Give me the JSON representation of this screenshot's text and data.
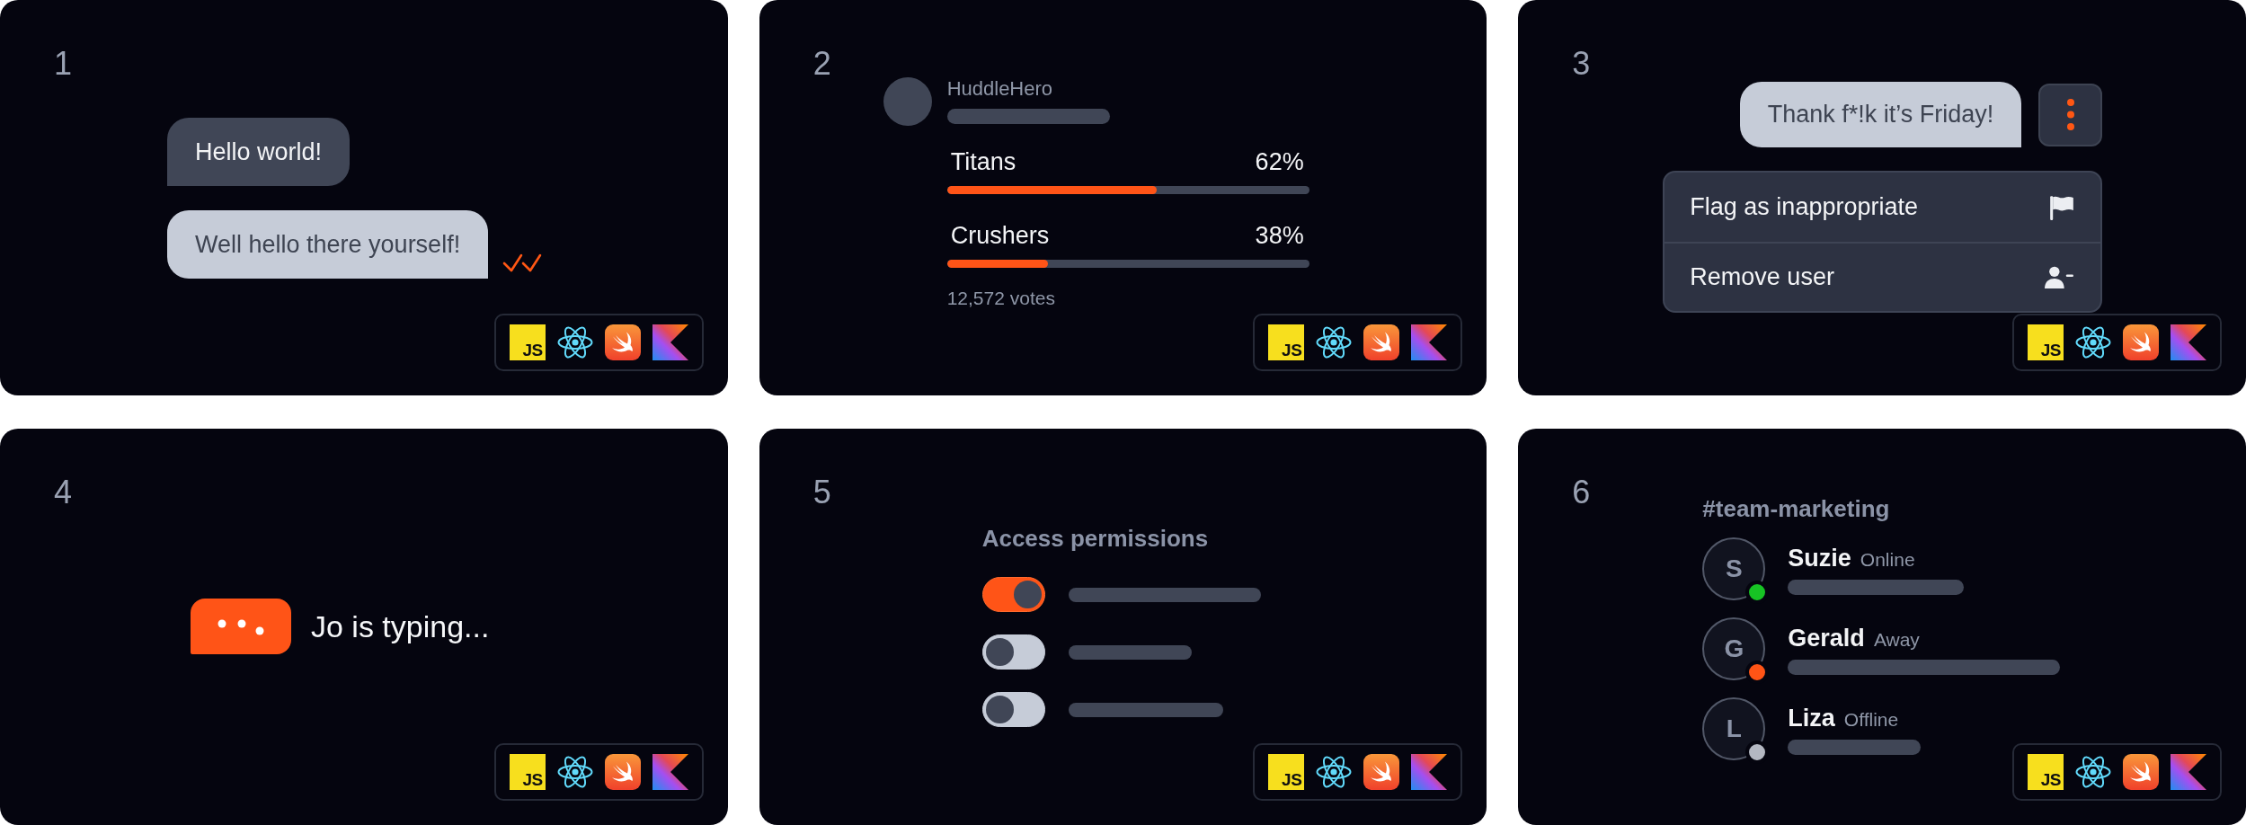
{
  "cards": [
    {
      "number": "1",
      "kind": "chat",
      "messages": [
        {
          "kind": "received",
          "text": "Hello world!"
        },
        {
          "kind": "sent",
          "text": "Well hello there yourself!",
          "read": true
        }
      ],
      "platforms": [
        {
          "kind": "js",
          "label": "JS"
        },
        {
          "kind": "react"
        },
        {
          "kind": "swift"
        },
        {
          "kind": "kotlin"
        }
      ]
    },
    {
      "number": "2",
      "kind": "poll",
      "author": "HuddleHero",
      "options": [
        {
          "label": "Titans",
          "percent": "62%",
          "level": 0.58
        },
        {
          "label": "Crushers",
          "percent": "38%",
          "level": 0.28
        }
      ],
      "votes": "12,572 votes",
      "platforms": [
        {
          "kind": "js",
          "label": "JS"
        },
        {
          "kind": "react"
        },
        {
          "kind": "swift"
        },
        {
          "kind": "kotlin"
        }
      ]
    },
    {
      "number": "3",
      "kind": "moderation",
      "message": "Thank f*!k it’s Friday!",
      "menu": [
        {
          "kind": "flag",
          "label": "Flag as inappropriate"
        },
        {
          "kind": "remove-user",
          "label": "Remove user"
        }
      ],
      "platforms": [
        {
          "kind": "js",
          "label": "JS"
        },
        {
          "kind": "react"
        },
        {
          "kind": "swift"
        },
        {
          "kind": "kotlin"
        }
      ]
    },
    {
      "number": "4",
      "kind": "typing",
      "text": "Jo is typing...",
      "platforms": [
        {
          "kind": "js",
          "label": "JS"
        },
        {
          "kind": "react"
        },
        {
          "kind": "swift"
        },
        {
          "kind": "kotlin"
        }
      ]
    },
    {
      "number": "5",
      "kind": "permissions",
      "title": "Access permissions",
      "permissions": [
        {
          "on": true
        },
        {
          "on": false
        },
        {
          "on": false
        }
      ],
      "platforms": [
        {
          "kind": "js",
          "label": "JS"
        },
        {
          "kind": "react"
        },
        {
          "kind": "swift"
        },
        {
          "kind": "kotlin"
        }
      ]
    },
    {
      "number": "6",
      "kind": "team",
      "channel": "#team-marketing",
      "members": [
        {
          "initial": "S",
          "name": "Suzie",
          "status": "Online",
          "color": "#17c324"
        },
        {
          "initial": "G",
          "name": "Gerald",
          "status": "Away",
          "color": "#ff5416"
        },
        {
          "initial": "L",
          "name": "Liza",
          "status": "Offline",
          "color": "#b4b8c2"
        }
      ],
      "platforms": [
        {
          "kind": "js",
          "label": "JS"
        },
        {
          "kind": "react"
        },
        {
          "kind": "swift"
        },
        {
          "kind": "kotlin"
        }
      ]
    }
  ]
}
